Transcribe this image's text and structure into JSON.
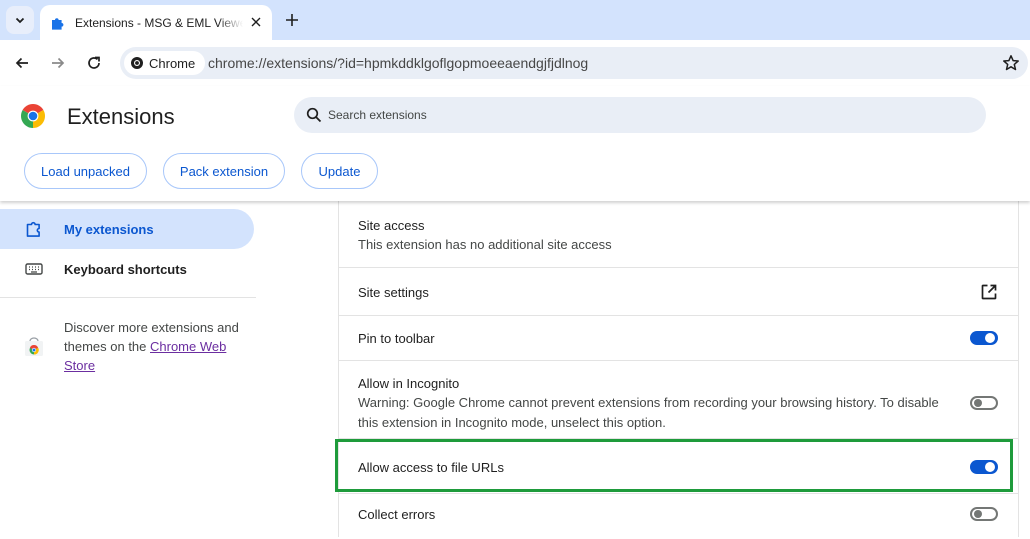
{
  "browser": {
    "tab": {
      "title": "Extensions - MSG & EML Viewer",
      "favicon": "puzzle-icon"
    },
    "omnibox": {
      "chip_label": "Chrome",
      "url": "chrome://extensions/?id=hpmkddklgoflgopmoeeaendgjfjdlnog"
    }
  },
  "header": {
    "title": "Extensions",
    "search_placeholder": "Search extensions",
    "buttons": {
      "load_unpacked": "Load unpacked",
      "pack_extension": "Pack extension",
      "update": "Update"
    }
  },
  "sidebar": {
    "items": [
      {
        "label": "My extensions",
        "icon": "extension-icon",
        "active": true
      },
      {
        "label": "Keyboard shortcuts",
        "icon": "keyboard-icon",
        "active": false
      }
    ],
    "discover_text": "Discover more extensions and themes on the ",
    "discover_link": "Chrome Web Store"
  },
  "details": {
    "site_access": {
      "title": "Site access",
      "subtitle": "This extension has no additional site access"
    },
    "site_settings": {
      "title": "Site settings"
    },
    "pin_to_toolbar": {
      "title": "Pin to toolbar",
      "enabled": true
    },
    "incognito": {
      "title": "Allow in Incognito",
      "warning": "Warning: Google Chrome cannot prevent extensions from recording your browsing history. To disable this extension in Incognito mode, unselect this option.",
      "enabled": false
    },
    "file_urls": {
      "title": "Allow access to file URLs",
      "enabled": true
    },
    "collect_errors": {
      "title": "Collect errors",
      "enabled": false
    }
  },
  "colors": {
    "accent": "#0b57d0",
    "highlight": "#1e9b3b",
    "tabstrip": "#d3e3fd"
  }
}
